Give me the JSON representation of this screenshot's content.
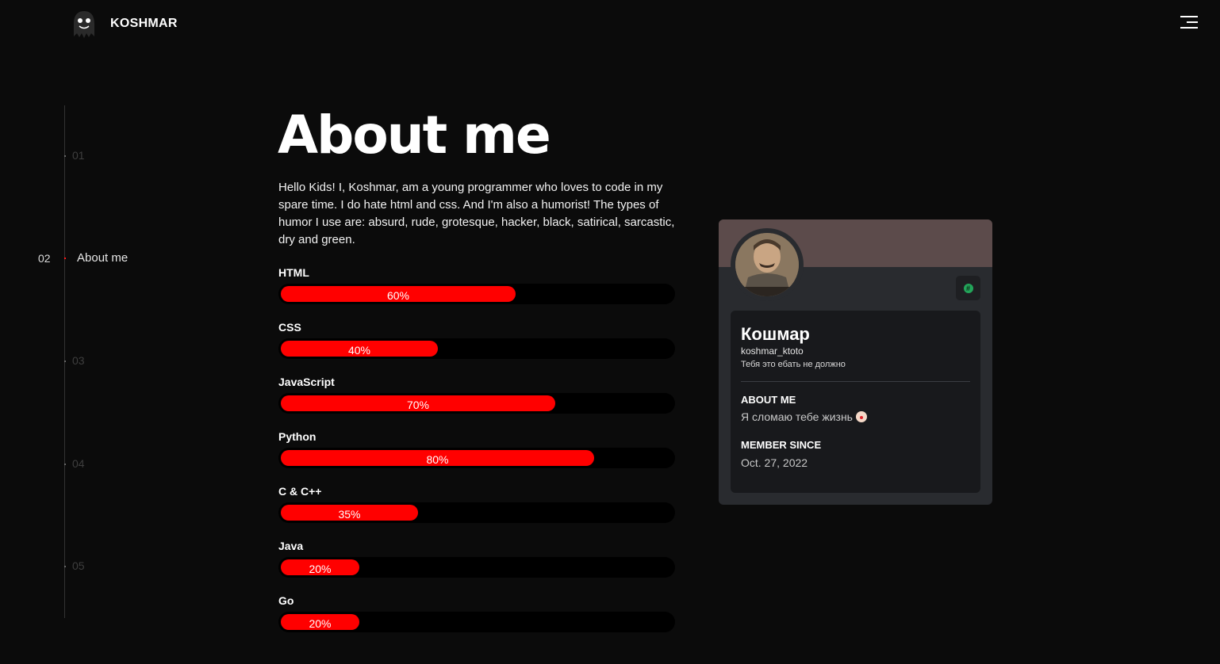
{
  "header": {
    "brand": "KOSHMAR",
    "logo_icon": "ghost-icon",
    "menu_icon": "hamburger-menu-icon"
  },
  "sidenav": {
    "items": [
      {
        "num": "01",
        "label": "",
        "active": false
      },
      {
        "num": "02",
        "label": "About me",
        "active": true
      },
      {
        "num": "03",
        "label": "",
        "active": false
      },
      {
        "num": "04",
        "label": "",
        "active": false
      },
      {
        "num": "05",
        "label": "",
        "active": false
      }
    ]
  },
  "main": {
    "title": "About me",
    "intro": "Hello Kids! I, Koshmar, am a young programmer who loves to code in my spare time. I do hate html and css. And I'm also a humorist! The types of humor I use are: absurd, rude, grotesque, hacker, black, satirical, sarcastic, dry and green.",
    "skills": [
      {
        "name": "HTML",
        "percent": 60,
        "label": "60%"
      },
      {
        "name": "CSS",
        "percent": 40,
        "label": "40%"
      },
      {
        "name": "JavaScript",
        "percent": 70,
        "label": "70%"
      },
      {
        "name": "Python",
        "percent": 80,
        "label": "80%"
      },
      {
        "name": "C & C++",
        "percent": 35,
        "label": "35%"
      },
      {
        "name": "Java",
        "percent": 20,
        "label": "20%"
      },
      {
        "name": "Go",
        "percent": 20,
        "label": "20%"
      }
    ]
  },
  "profile": {
    "display_name": "Кошмар",
    "username": "koshmar_ktoto",
    "status": "Тебя это ебать не должно",
    "about_heading": "ABOUT ME",
    "about_text": "Я сломаю тебе жизнь",
    "about_emoji": "clown-face-icon",
    "member_heading": "MEMBER SINCE",
    "member_since": "Oct. 27, 2022",
    "badge_icon": "hashtag-badge-icon",
    "banner_color": "#5c4b4b"
  },
  "colors": {
    "accent": "#ff0000",
    "background": "#0b0b0b",
    "card": "#292b2f"
  }
}
